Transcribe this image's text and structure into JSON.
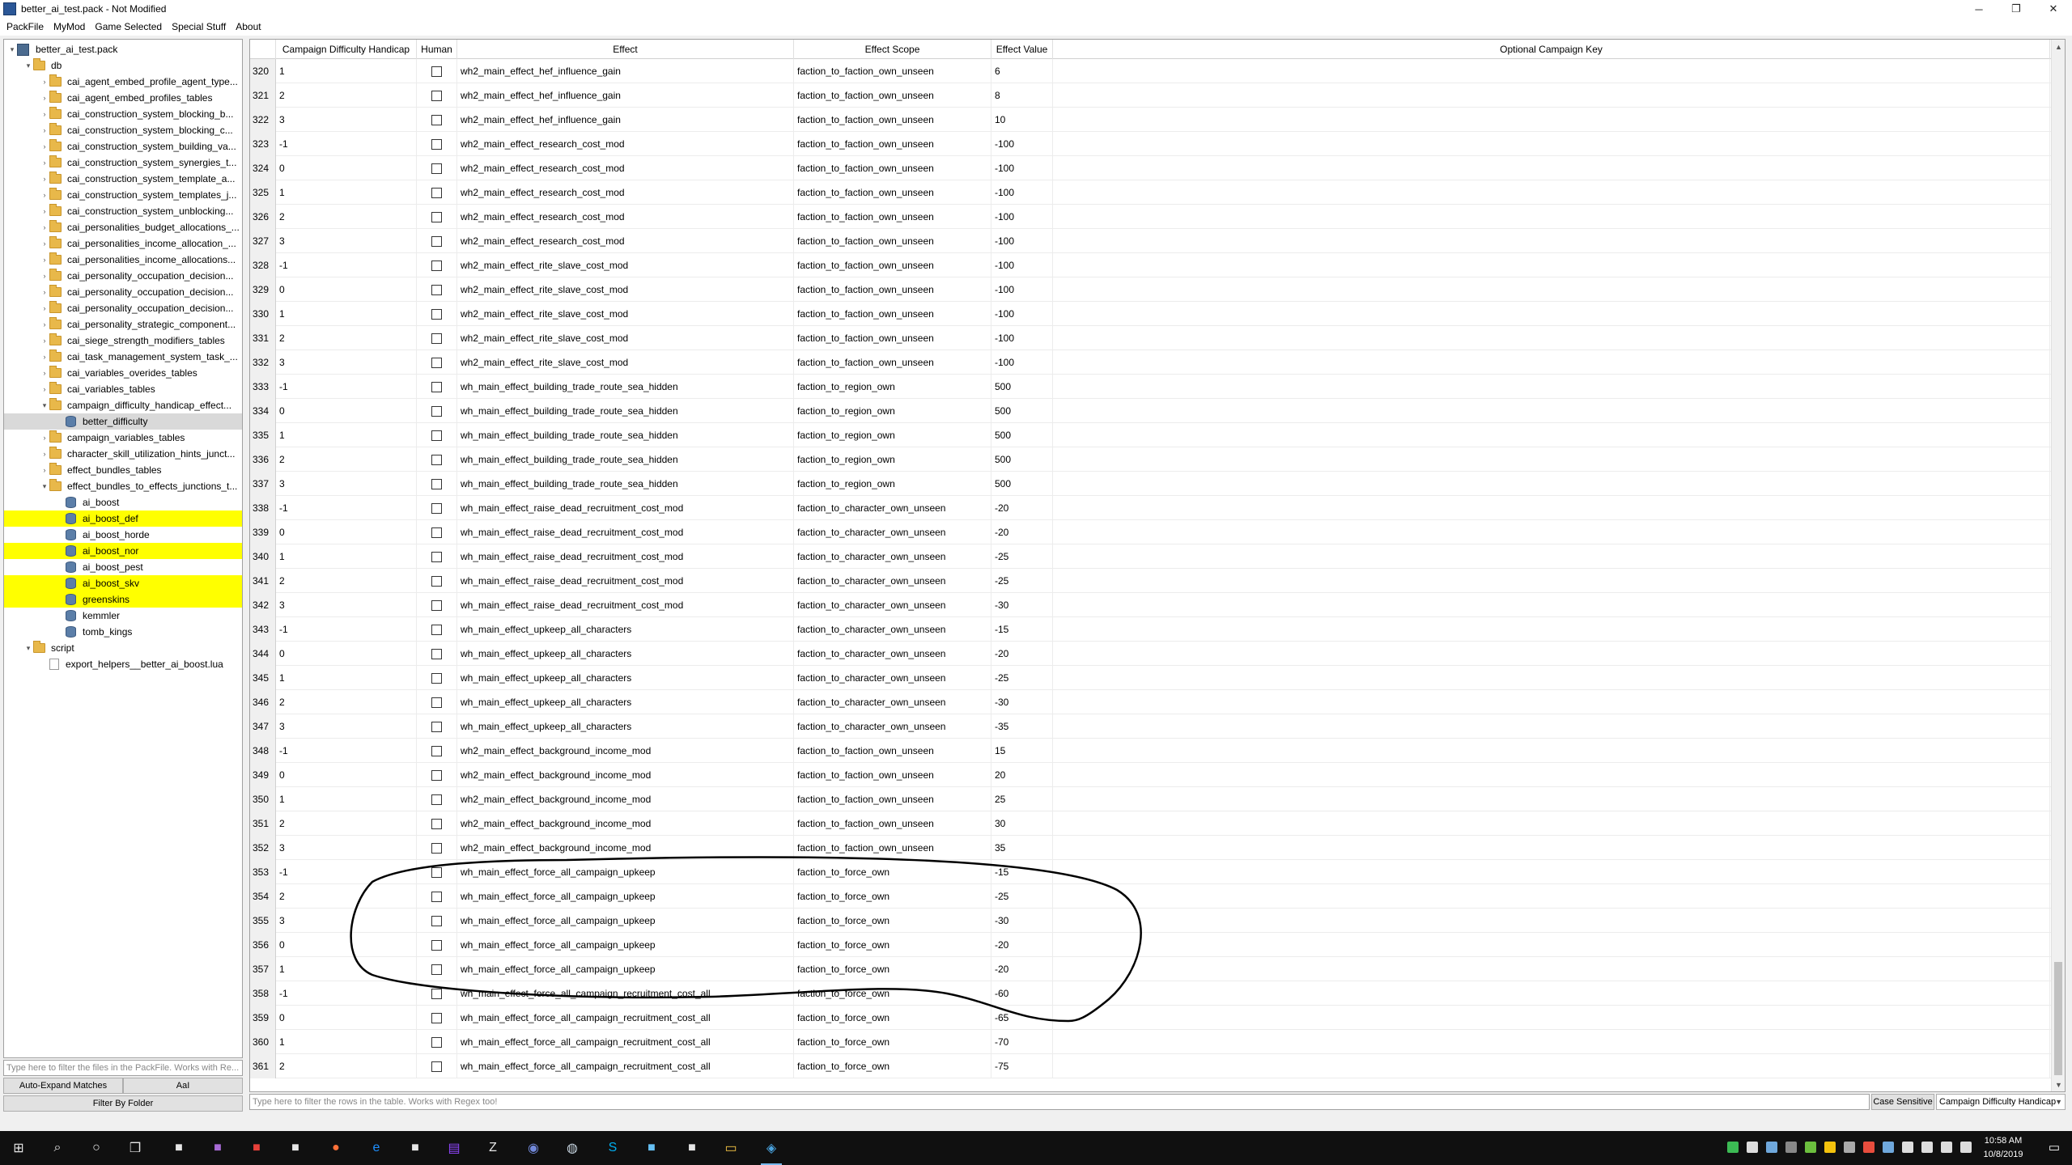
{
  "window": {
    "title": "better_ai_test.pack - Not Modified",
    "minimize_glyph": "─",
    "maximize_glyph": "❐",
    "close_glyph": "✕"
  },
  "menu": [
    "PackFile",
    "MyMod",
    "Game Selected",
    "Special Stuff",
    "About"
  ],
  "tree": [
    {
      "label": "better_ai_test.pack",
      "depth": 0,
      "type": "pack",
      "expanded": true
    },
    {
      "label": "db",
      "depth": 1,
      "type": "folder",
      "expanded": true
    },
    {
      "label": "cai_agent_embed_profile_agent_type...",
      "depth": 2,
      "type": "folder",
      "expanded": false
    },
    {
      "label": "cai_agent_embed_profiles_tables",
      "depth": 2,
      "type": "folder",
      "expanded": false
    },
    {
      "label": "cai_construction_system_blocking_b...",
      "depth": 2,
      "type": "folder",
      "expanded": false
    },
    {
      "label": "cai_construction_system_blocking_c...",
      "depth": 2,
      "type": "folder",
      "expanded": false
    },
    {
      "label": "cai_construction_system_building_va...",
      "depth": 2,
      "type": "folder",
      "expanded": false
    },
    {
      "label": "cai_construction_system_synergies_t...",
      "depth": 2,
      "type": "folder",
      "expanded": false
    },
    {
      "label": "cai_construction_system_template_a...",
      "depth": 2,
      "type": "folder",
      "expanded": false
    },
    {
      "label": "cai_construction_system_templates_j...",
      "depth": 2,
      "type": "folder",
      "expanded": false
    },
    {
      "label": "cai_construction_system_unblocking...",
      "depth": 2,
      "type": "folder",
      "expanded": false
    },
    {
      "label": "cai_personalities_budget_allocations_...",
      "depth": 2,
      "type": "folder",
      "expanded": false
    },
    {
      "label": "cai_personalities_income_allocation_...",
      "depth": 2,
      "type": "folder",
      "expanded": false
    },
    {
      "label": "cai_personalities_income_allocations...",
      "depth": 2,
      "type": "folder",
      "expanded": false
    },
    {
      "label": "cai_personality_occupation_decision...",
      "depth": 2,
      "type": "folder",
      "expanded": false
    },
    {
      "label": "cai_personality_occupation_decision...",
      "depth": 2,
      "type": "folder",
      "expanded": false
    },
    {
      "label": "cai_personality_occupation_decision...",
      "depth": 2,
      "type": "folder",
      "expanded": false
    },
    {
      "label": "cai_personality_strategic_component...",
      "depth": 2,
      "type": "folder",
      "expanded": false
    },
    {
      "label": "cai_siege_strength_modifiers_tables",
      "depth": 2,
      "type": "folder",
      "expanded": false
    },
    {
      "label": "cai_task_management_system_task_...",
      "depth": 2,
      "type": "folder",
      "expanded": false
    },
    {
      "label": "cai_variables_overides_tables",
      "depth": 2,
      "type": "folder",
      "expanded": false
    },
    {
      "label": "cai_variables_tables",
      "depth": 2,
      "type": "folder",
      "expanded": false
    },
    {
      "label": "campaign_difficulty_handicap_effect...",
      "depth": 2,
      "type": "folder",
      "expanded": true
    },
    {
      "label": "better_difficulty",
      "depth": 3,
      "type": "table",
      "selected": true
    },
    {
      "label": "campaign_variables_tables",
      "depth": 2,
      "type": "folder",
      "expanded": false
    },
    {
      "label": "character_skill_utilization_hints_junct...",
      "depth": 2,
      "type": "folder",
      "expanded": false
    },
    {
      "label": "effect_bundles_tables",
      "depth": 2,
      "type": "folder",
      "expanded": false
    },
    {
      "label": "effect_bundles_to_effects_junctions_t...",
      "depth": 2,
      "type": "folder",
      "expanded": true
    },
    {
      "label": "ai_boost",
      "depth": 3,
      "type": "table"
    },
    {
      "label": "ai_boost_def",
      "depth": 3,
      "type": "table",
      "highlight": true
    },
    {
      "label": "ai_boost_horde",
      "depth": 3,
      "type": "table"
    },
    {
      "label": "ai_boost_nor",
      "depth": 3,
      "type": "table",
      "highlight": true
    },
    {
      "label": "ai_boost_pest",
      "depth": 3,
      "type": "table"
    },
    {
      "label": "ai_boost_skv",
      "depth": 3,
      "type": "table",
      "highlight": true
    },
    {
      "label": "greenskins",
      "depth": 3,
      "type": "table",
      "highlight": true
    },
    {
      "label": "kemmler",
      "depth": 3,
      "type": "table"
    },
    {
      "label": "tomb_kings",
      "depth": 3,
      "type": "table"
    },
    {
      "label": "script",
      "depth": 1,
      "type": "folder",
      "expanded": true
    },
    {
      "label": "export_helpers__better_ai_boost.lua",
      "depth": 2,
      "type": "file"
    }
  ],
  "tree_filter": {
    "placeholder": "Type here to filter the files in the PackFile. Works with Re..."
  },
  "buttons": {
    "auto_expand": "Auto-Expand Matches",
    "aai": "AaI",
    "filter_by_folder": "Filter By Folder",
    "case_sensitive": "Case Sensitive"
  },
  "row_filter": {
    "placeholder": "Type here to filter the rows in the table. Works with Regex too!"
  },
  "column_select": {
    "value": "Campaign Difficulty Handicap"
  },
  "table": {
    "columns": [
      "Campaign Difficulty Handicap",
      "Human",
      "Effect",
      "Effect Scope",
      "Effect Value",
      "Optional Campaign Key"
    ],
    "rows": [
      {
        "n": "320",
        "h": "1",
        "e": "wh2_main_effect_hef_influence_gain",
        "s": "faction_to_faction_own_unseen",
        "v": "6"
      },
      {
        "n": "321",
        "h": "2",
        "e": "wh2_main_effect_hef_influence_gain",
        "s": "faction_to_faction_own_unseen",
        "v": "8"
      },
      {
        "n": "322",
        "h": "3",
        "e": "wh2_main_effect_hef_influence_gain",
        "s": "faction_to_faction_own_unseen",
        "v": "10"
      },
      {
        "n": "323",
        "h": "-1",
        "e": "wh2_main_effect_research_cost_mod",
        "s": "faction_to_faction_own_unseen",
        "v": "-100"
      },
      {
        "n": "324",
        "h": "0",
        "e": "wh2_main_effect_research_cost_mod",
        "s": "faction_to_faction_own_unseen",
        "v": "-100"
      },
      {
        "n": "325",
        "h": "1",
        "e": "wh2_main_effect_research_cost_mod",
        "s": "faction_to_faction_own_unseen",
        "v": "-100"
      },
      {
        "n": "326",
        "h": "2",
        "e": "wh2_main_effect_research_cost_mod",
        "s": "faction_to_faction_own_unseen",
        "v": "-100"
      },
      {
        "n": "327",
        "h": "3",
        "e": "wh2_main_effect_research_cost_mod",
        "s": "faction_to_faction_own_unseen",
        "v": "-100"
      },
      {
        "n": "328",
        "h": "-1",
        "e": "wh2_main_effect_rite_slave_cost_mod",
        "s": "faction_to_faction_own_unseen",
        "v": "-100"
      },
      {
        "n": "329",
        "h": "0",
        "e": "wh2_main_effect_rite_slave_cost_mod",
        "s": "faction_to_faction_own_unseen",
        "v": "-100"
      },
      {
        "n": "330",
        "h": "1",
        "e": "wh2_main_effect_rite_slave_cost_mod",
        "s": "faction_to_faction_own_unseen",
        "v": "-100"
      },
      {
        "n": "331",
        "h": "2",
        "e": "wh2_main_effect_rite_slave_cost_mod",
        "s": "faction_to_faction_own_unseen",
        "v": "-100"
      },
      {
        "n": "332",
        "h": "3",
        "e": "wh2_main_effect_rite_slave_cost_mod",
        "s": "faction_to_faction_own_unseen",
        "v": "-100"
      },
      {
        "n": "333",
        "h": "-1",
        "e": "wh_main_effect_building_trade_route_sea_hidden",
        "s": "faction_to_region_own",
        "v": "500"
      },
      {
        "n": "334",
        "h": "0",
        "e": "wh_main_effect_building_trade_route_sea_hidden",
        "s": "faction_to_region_own",
        "v": "500"
      },
      {
        "n": "335",
        "h": "1",
        "e": "wh_main_effect_building_trade_route_sea_hidden",
        "s": "faction_to_region_own",
        "v": "500"
      },
      {
        "n": "336",
        "h": "2",
        "e": "wh_main_effect_building_trade_route_sea_hidden",
        "s": "faction_to_region_own",
        "v": "500"
      },
      {
        "n": "337",
        "h": "3",
        "e": "wh_main_effect_building_trade_route_sea_hidden",
        "s": "faction_to_region_own",
        "v": "500"
      },
      {
        "n": "338",
        "h": "-1",
        "e": "wh_main_effect_raise_dead_recruitment_cost_mod",
        "s": "faction_to_character_own_unseen",
        "v": "-20"
      },
      {
        "n": "339",
        "h": "0",
        "e": "wh_main_effect_raise_dead_recruitment_cost_mod",
        "s": "faction_to_character_own_unseen",
        "v": "-20"
      },
      {
        "n": "340",
        "h": "1",
        "e": "wh_main_effect_raise_dead_recruitment_cost_mod",
        "s": "faction_to_character_own_unseen",
        "v": "-25"
      },
      {
        "n": "341",
        "h": "2",
        "e": "wh_main_effect_raise_dead_recruitment_cost_mod",
        "s": "faction_to_character_own_unseen",
        "v": "-25"
      },
      {
        "n": "342",
        "h": "3",
        "e": "wh_main_effect_raise_dead_recruitment_cost_mod",
        "s": "faction_to_character_own_unseen",
        "v": "-30"
      },
      {
        "n": "343",
        "h": "-1",
        "e": "wh_main_effect_upkeep_all_characters",
        "s": "faction_to_character_own_unseen",
        "v": "-15"
      },
      {
        "n": "344",
        "h": "0",
        "e": "wh_main_effect_upkeep_all_characters",
        "s": "faction_to_character_own_unseen",
        "v": "-20"
      },
      {
        "n": "345",
        "h": "1",
        "e": "wh_main_effect_upkeep_all_characters",
        "s": "faction_to_character_own_unseen",
        "v": "-25"
      },
      {
        "n": "346",
        "h": "2",
        "e": "wh_main_effect_upkeep_all_characters",
        "s": "faction_to_character_own_unseen",
        "v": "-30"
      },
      {
        "n": "347",
        "h": "3",
        "e": "wh_main_effect_upkeep_all_characters",
        "s": "faction_to_character_own_unseen",
        "v": "-35"
      },
      {
        "n": "348",
        "h": "-1",
        "e": "wh2_main_effect_background_income_mod",
        "s": "faction_to_faction_own_unseen",
        "v": "15"
      },
      {
        "n": "349",
        "h": "0",
        "e": "wh2_main_effect_background_income_mod",
        "s": "faction_to_faction_own_unseen",
        "v": "20"
      },
      {
        "n": "350",
        "h": "1",
        "e": "wh2_main_effect_background_income_mod",
        "s": "faction_to_faction_own_unseen",
        "v": "25"
      },
      {
        "n": "351",
        "h": "2",
        "e": "wh2_main_effect_background_income_mod",
        "s": "faction_to_faction_own_unseen",
        "v": "30"
      },
      {
        "n": "352",
        "h": "3",
        "e": "wh2_main_effect_background_income_mod",
        "s": "faction_to_faction_own_unseen",
        "v": "35"
      },
      {
        "n": "353",
        "h": "-1",
        "e": "wh_main_effect_force_all_campaign_upkeep",
        "s": "faction_to_force_own",
        "v": "-15"
      },
      {
        "n": "354",
        "h": "2",
        "e": "wh_main_effect_force_all_campaign_upkeep",
        "s": "faction_to_force_own",
        "v": "-25"
      },
      {
        "n": "355",
        "h": "3",
        "e": "wh_main_effect_force_all_campaign_upkeep",
        "s": "faction_to_force_own",
        "v": "-30"
      },
      {
        "n": "356",
        "h": "0",
        "e": "wh_main_effect_force_all_campaign_upkeep",
        "s": "faction_to_force_own",
        "v": "-20"
      },
      {
        "n": "357",
        "h": "1",
        "e": "wh_main_effect_force_all_campaign_upkeep",
        "s": "faction_to_force_own",
        "v": "-20"
      },
      {
        "n": "358",
        "h": "-1",
        "e": "wh_main_effect_force_all_campaign_recruitment_cost_all",
        "s": "faction_to_force_own",
        "v": "-60"
      },
      {
        "n": "359",
        "h": "0",
        "e": "wh_main_effect_force_all_campaign_recruitment_cost_all",
        "s": "faction_to_force_own",
        "v": "-65"
      },
      {
        "n": "360",
        "h": "1",
        "e": "wh_main_effect_force_all_campaign_recruitment_cost_all",
        "s": "faction_to_force_own",
        "v": "-70"
      },
      {
        "n": "361",
        "h": "2",
        "e": "wh_main_effect_force_all_campaign_recruitment_cost_all",
        "s": "faction_to_force_own",
        "v": "-75"
      }
    ]
  },
  "taskbar": {
    "icons": [
      "windows-start-icon",
      "search-icon",
      "cortana-icon",
      "task-view-icon",
      "app-icon-1",
      "app-icon-2",
      "app-icon-3",
      "app-icon-4",
      "firefox-icon",
      "edge-icon",
      "app-icon-5",
      "twitch-icon",
      "zotero-icon",
      "discord-icon",
      "steam-icon",
      "skype-icon",
      "steam-alt-icon",
      "app-icon-6",
      "file-explorer-icon",
      "rpfm-icon"
    ],
    "time": "10:58 AM",
    "date": "10/8/2019"
  }
}
